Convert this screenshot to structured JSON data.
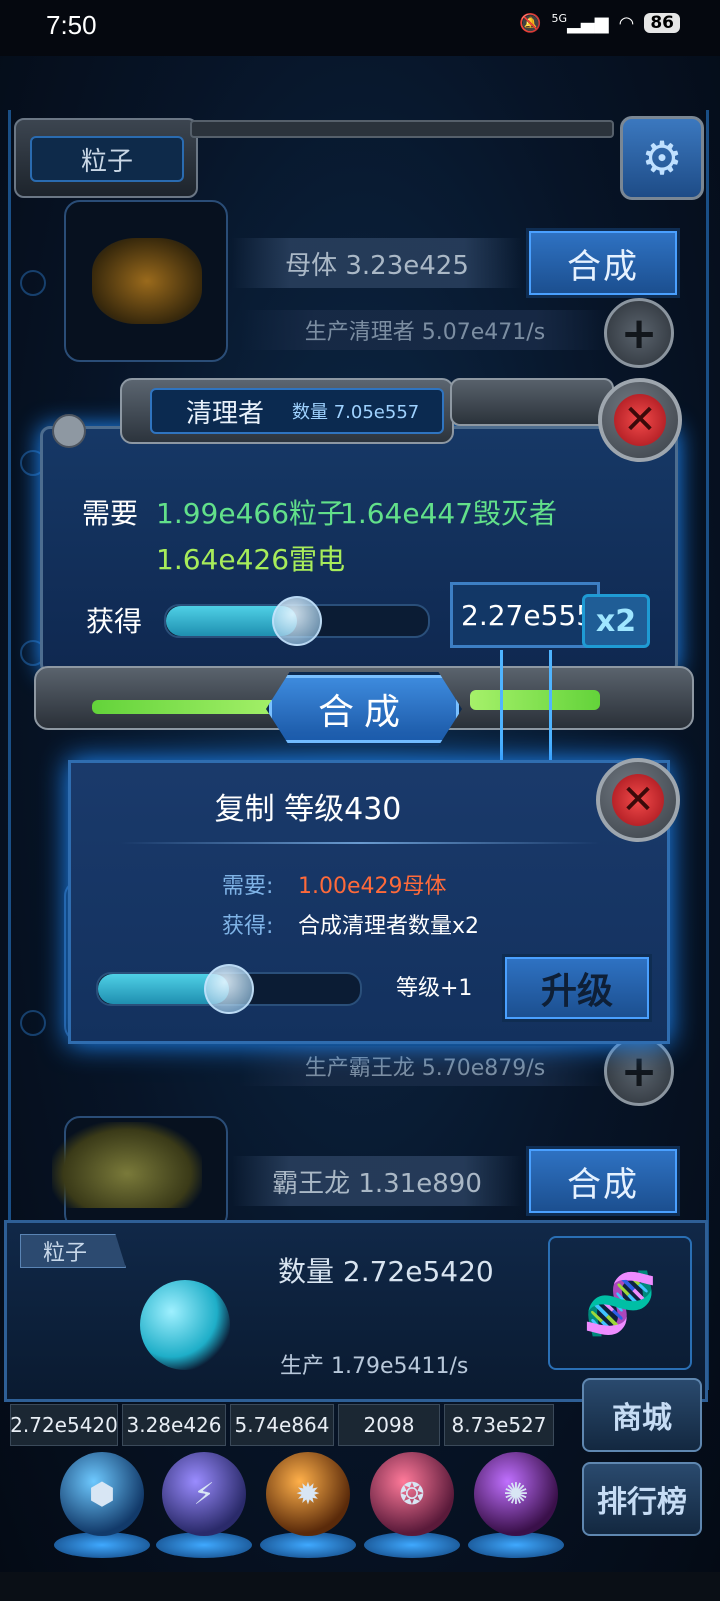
{
  "status_bar": {
    "time": "7:50",
    "network": "5G",
    "battery": "86"
  },
  "header": {
    "tab_label": "粒子"
  },
  "rows": [
    {
      "name": "母体 3.23e425",
      "production": "生产清理者 5.07e471/s",
      "synth_label": "合成"
    },
    {
      "production": "生产霸王龙 5.70e879/s"
    },
    {
      "name": "霸王龙 1.31e890",
      "synth_label": "合成"
    }
  ],
  "synth_modal": {
    "title": "清理者",
    "count": "数量 7.05e557",
    "need_label": "需要",
    "requirements": [
      "1.99e466粒子",
      "1.64e447毁灭者",
      "1.64e426雷电"
    ],
    "get_label": "获得",
    "slider_fraction": 0.5,
    "yield_value": "2.27e555",
    "multiplier": "x2",
    "synth_button": "合成"
  },
  "copy_modal": {
    "title": "复制 等级430",
    "need_label": "需要:",
    "need_value": "1.00e429母体",
    "get_label": "获得:",
    "get_value": "合成清理者数量x2",
    "slider_fraction": 0.5,
    "level_step": "等级+1",
    "upgrade_button": "升级"
  },
  "resource_panel": {
    "tab_label": "粒子",
    "count": "数量 2.72e5420",
    "production": "生产 1.79e5411/s"
  },
  "resource_strip": [
    "2.72e5420",
    "3.28e426",
    "5.74e864",
    "2098",
    "8.73e527"
  ],
  "side_buttons": {
    "shop": "商城",
    "ranking": "排行榜"
  },
  "colors": {
    "requirement_green": "#62e08a",
    "requirement_yellow_green": "#a7ec5a",
    "cost_orange": "#ff6a3a",
    "panel_blue": "#163866",
    "glow_blue": "#1f8cff"
  },
  "icons": {
    "settings": "gear-icon",
    "close": "close-icon",
    "add": "plus-icon",
    "dna": "dna-icon"
  }
}
